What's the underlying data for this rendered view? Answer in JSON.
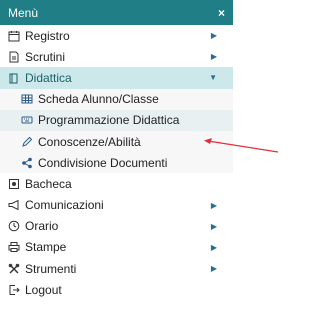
{
  "header": {
    "title": "Menù",
    "close_glyph": "×"
  },
  "items": [
    {
      "label": "Registro",
      "icon": "calendar-icon",
      "has_submenu": true
    },
    {
      "label": "Scrutini",
      "icon": "document-icon",
      "has_submenu": true
    },
    {
      "label": "Didattica",
      "icon": "book-icon",
      "has_submenu": true,
      "expanded": true
    },
    {
      "label": "Scheda Alunno/Classe",
      "icon": "table-icon",
      "sub": true
    },
    {
      "label": "Programmazione Didattica",
      "icon": "keyboard-icon",
      "sub": true
    },
    {
      "label": "Conoscenze/Abilità",
      "icon": "pencil-icon",
      "sub": true
    },
    {
      "label": "Condivisione Documenti",
      "icon": "share-icon",
      "sub": true
    },
    {
      "label": "Bacheca",
      "icon": "bulletin-icon",
      "has_submenu": false
    },
    {
      "label": "Comunicazioni",
      "icon": "megaphone-icon",
      "has_submenu": true
    },
    {
      "label": "Orario",
      "icon": "clock-icon",
      "has_submenu": true
    },
    {
      "label": "Stampe",
      "icon": "printer-icon",
      "has_submenu": true
    },
    {
      "label": "Strumenti",
      "icon": "tools-icon",
      "has_submenu": true
    },
    {
      "label": "Logout",
      "icon": "logout-icon",
      "has_submenu": false
    }
  ],
  "colors": {
    "header_bg": "#1f7e86",
    "active_bg": "#cde8ea",
    "arrow": "#2a6e8e",
    "annotation_arrow": "#e0303a"
  }
}
